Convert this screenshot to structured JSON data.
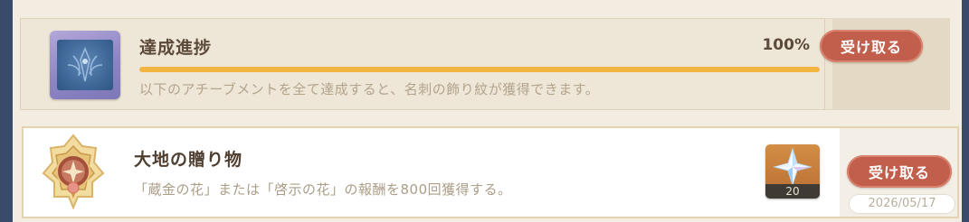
{
  "achievement_card": {
    "title": "達成進捗",
    "percent": "100%",
    "progress": 1.0,
    "description": "以下のアチーブメントを全て達成すると、名刺の飾り紋が獲得できます。",
    "icon": "namecard-icon",
    "claim_label": "受け取る"
  },
  "reward_card": {
    "title": "大地の贈り物",
    "description": "「蔵金の花」または「啓示の花」の報酬を800回獲得する。",
    "icon": "achievement-badge-icon",
    "reward_item": {
      "icon": "primogem-icon",
      "quantity": "20"
    },
    "claim_label": "受け取る",
    "date": "2026/05/17"
  },
  "colors": {
    "claim_button": "#c25f4c",
    "progress_fill": "#f2b53f",
    "title_text": "#5b4a3a",
    "muted_text": "#b3a48c"
  }
}
